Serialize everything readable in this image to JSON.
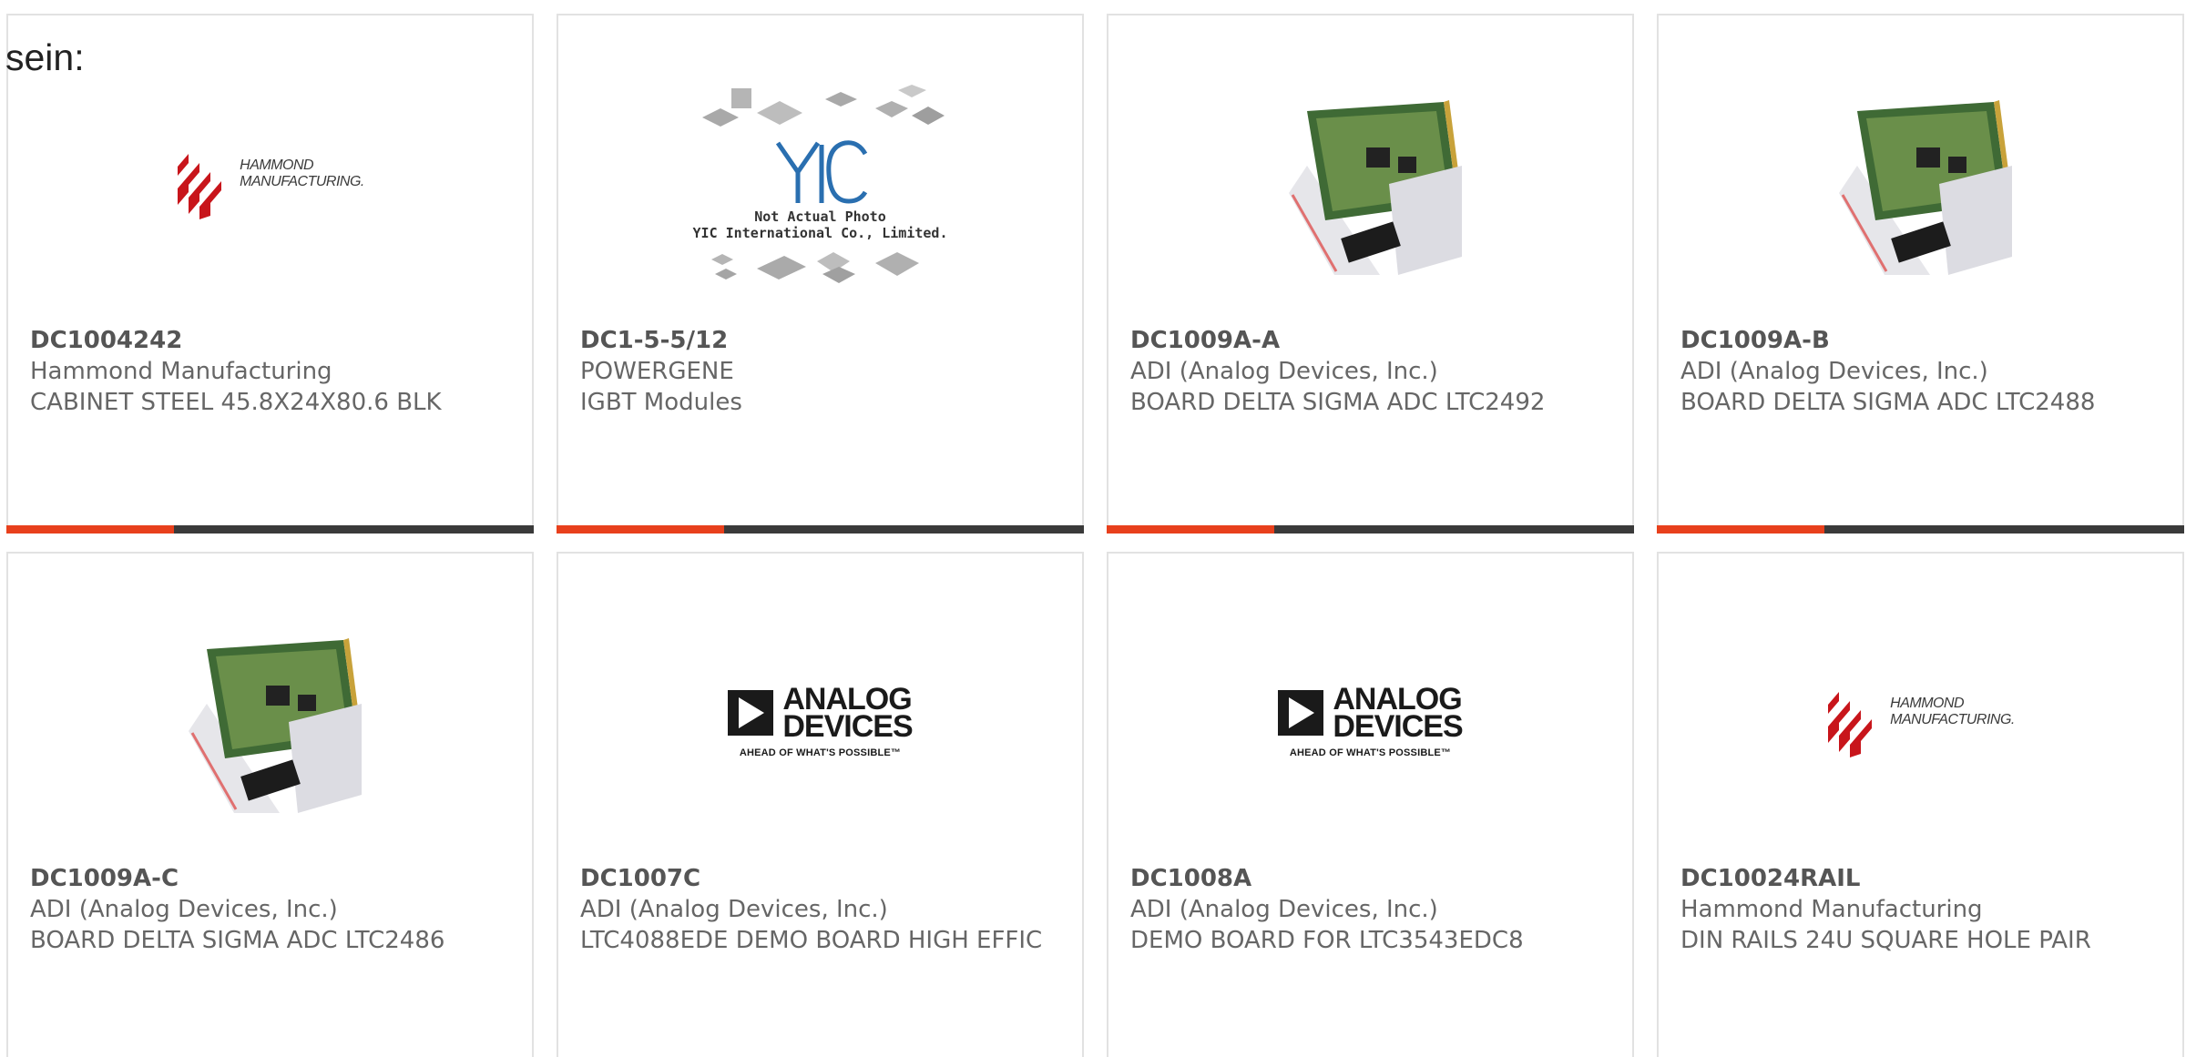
{
  "page_fragment": "sein:",
  "colors": {
    "accent": "#e8401c",
    "bar": "#3a3a3a",
    "border": "#e2e2e2",
    "text": "#666666"
  },
  "products": [
    {
      "part_no": "DC1004242",
      "manufacturer": "Hammond Manufacturing",
      "description": "CABINET STEEL 45.8X24X80.6 BLK",
      "image": "hammond-logo",
      "logo_text_1": "HAMMOND",
      "logo_text_2": "MANUFACTURING."
    },
    {
      "part_no": "DC1-5-5/12",
      "manufacturer": "POWERGENE",
      "description": "IGBT Modules",
      "image": "yic-not-actual-photo",
      "logo_text_1": "Not Actual Photo",
      "logo_text_2": "YIC International Co., Limited."
    },
    {
      "part_no": "DC1009A-A",
      "manufacturer": "ADI (Analog Devices, Inc.)",
      "description": "BOARD DELTA SIGMA ADC LTC2492",
      "image": "pcb-board-photo"
    },
    {
      "part_no": "DC1009A-B",
      "manufacturer": "ADI (Analog Devices, Inc.)",
      "description": "BOARD DELTA SIGMA ADC LTC2488",
      "image": "pcb-board-photo"
    },
    {
      "part_no": "DC1009A-C",
      "manufacturer": "ADI (Analog Devices, Inc.)",
      "description": "BOARD DELTA SIGMA ADC LTC2486",
      "image": "pcb-board-photo"
    },
    {
      "part_no": "DC1007C",
      "manufacturer": "ADI (Analog Devices, Inc.)",
      "description": "LTC4088EDE DEMO BOARD HIGH EFFIC",
      "image": "analog-devices-logo",
      "logo_text_1": "ANALOG",
      "logo_text_2": "DEVICES",
      "logo_tagline": "AHEAD OF WHAT'S POSSIBLE™"
    },
    {
      "part_no": "DC1008A",
      "manufacturer": "ADI (Analog Devices, Inc.)",
      "description": "DEMO BOARD FOR LTC3543EDC8",
      "image": "analog-devices-logo",
      "logo_text_1": "ANALOG",
      "logo_text_2": "DEVICES",
      "logo_tagline": "AHEAD OF WHAT'S POSSIBLE™"
    },
    {
      "part_no": "DC10024RAIL",
      "manufacturer": "Hammond Manufacturing",
      "description": "DIN RAILS 24U SQUARE HOLE PAIR",
      "image": "hammond-logo",
      "logo_text_1": "HAMMOND",
      "logo_text_2": "MANUFACTURING."
    }
  ]
}
